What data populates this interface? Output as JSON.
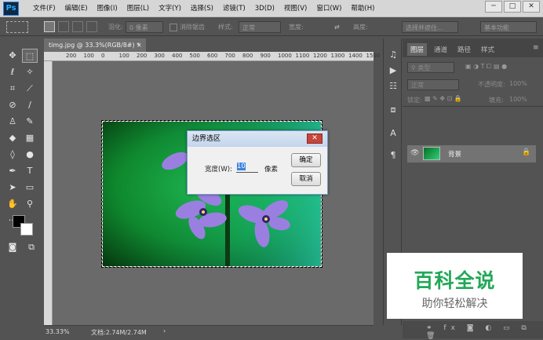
{
  "app": {
    "logo": "Ps"
  },
  "menu": [
    "文件(F)",
    "编辑(E)",
    "图像(I)",
    "图层(L)",
    "文字(Y)",
    "选择(S)",
    "滤镜(T)",
    "3D(D)",
    "视图(V)",
    "窗口(W)",
    "帮助(H)"
  ],
  "window_controls": {
    "minimize": "─",
    "maximize": "□",
    "close": "✕"
  },
  "options": {
    "feather_label": "羽化:",
    "feather_value": "0 像素",
    "antialias": "消除锯齿",
    "style_label": "样式:",
    "style_value": "正常",
    "width_label": "宽度:",
    "height_label": "高度:",
    "select_mask": "选择并遮住...",
    "workspace": "基本功能"
  },
  "document": {
    "tab_label": "timg.jpg @ 33.3%(RGB/8#) *",
    "tab_close": "×",
    "ruler_ticks": [
      "200",
      "100",
      "0",
      "100",
      "200",
      "300",
      "400",
      "500",
      "600",
      "700",
      "800",
      "900",
      "1000",
      "1100",
      "1200",
      "1300",
      "1400",
      "1500"
    ]
  },
  "status": {
    "zoom": "33.33%",
    "doc_info": "文档:2.74M/2.74M",
    "arrow": "›"
  },
  "dialog": {
    "title": "边界选区",
    "close": "✕",
    "width_label": "宽度(W):",
    "width_value": "10",
    "unit": "像素",
    "ok": "确定",
    "cancel": "取消"
  },
  "layers_panel": {
    "tabs": [
      "图层",
      "通道",
      "路径",
      "样式"
    ],
    "filter_kind": "类型",
    "blend_mode": "正常",
    "opacity_label": "不透明度:",
    "opacity_value": "100%",
    "lock_label": "锁定:",
    "fill_label": "填充:",
    "fill_value": "100%",
    "layer_name": "背景"
  },
  "watermark": {
    "main": "百科全说",
    "sub": "助你轻松解决"
  }
}
